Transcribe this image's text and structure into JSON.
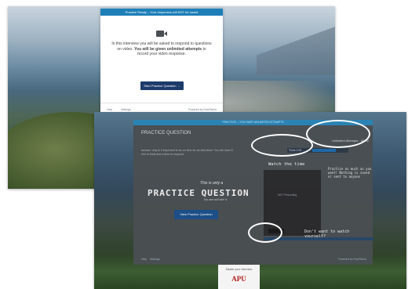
{
  "screenshot_top": {
    "modal": {
      "header": "Practice Ready – Your responses will NOT be saved",
      "camera_icon": "video-camera-icon",
      "message_part1": "In this interview you will  be asked to respond to questions on video.",
      "message_bold": "You will be given unlimited attempts",
      "message_part2": "to record your video response.",
      "start_button": "Start Practice Question →",
      "footer_help": "Help",
      "footer_settings": "Settings",
      "footer_powered": "Powered by Kira/Talent"
    }
  },
  "screenshot_bottom": {
    "top_bar": "PRACTICE – YOU HAVE UNLIMITED ATTEMPTS",
    "title": "PRACTICE QUESTION",
    "description": "Answer: why is it important to be on time for an interview? You will have 5 min to think and a time to respond",
    "this_is_only_a": "This is only a",
    "practice_question": "PRACTICE QUESTION",
    "no_one_will_see": "No one will see it.",
    "view_button": "View Practice Question",
    "timer_label": "Think 1:00",
    "attempts_note": "Unlimited Attempts · 00:00",
    "watch_the_time": "Watch the time",
    "video_text": "NOT Recording",
    "handwritten_note": "Practice as much as you want! Nothing is saved or sent to anyone",
    "dont_want": "Don't want to watch yourself?",
    "footer_help": "Help",
    "footer_settings": "Settings",
    "footer_powered": "Powered by Kira/Talent"
  },
  "logo": {
    "caption": "Master your interview",
    "name": "APU"
  },
  "colors": {
    "accent_blue": "#1e7fb8",
    "button_navy": "#1c3b6b",
    "logo_red": "#b01b1b"
  }
}
